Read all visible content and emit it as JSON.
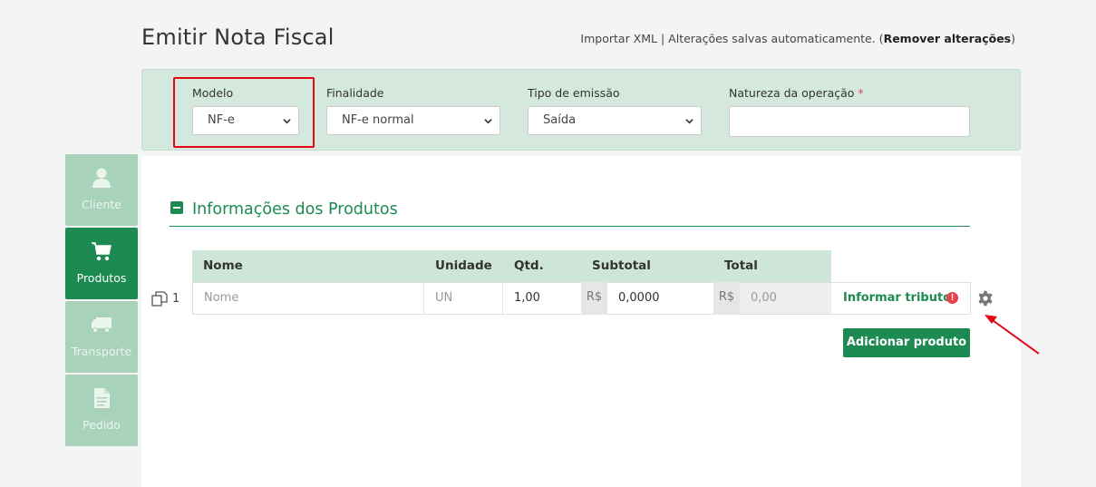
{
  "page": {
    "title": "Emitir Nota Fiscal",
    "import_xml": "Importar XML",
    "separator": " | ",
    "autosave": "Alterações salvas automaticamente. (",
    "remove_changes": "Remover alterações",
    "close_paren": ")"
  },
  "header_form": {
    "modelo": {
      "label": "Modelo",
      "value": "NF-e"
    },
    "finalidade": {
      "label": "Finalidade",
      "value": "NF-e normal"
    },
    "tipo_emissao": {
      "label": "Tipo de emissão",
      "value": "Saída"
    },
    "natureza": {
      "label": "Natureza da operação",
      "required_mark": "*",
      "value": ""
    }
  },
  "sidenav": {
    "items": [
      {
        "label": "Cliente",
        "icon": "user-icon",
        "active": false
      },
      {
        "label": "Produtos",
        "icon": "cart-icon",
        "active": true
      },
      {
        "label": "Transporte",
        "icon": "truck-icon",
        "active": false
      },
      {
        "label": "Pedido",
        "icon": "document-icon",
        "active": false
      }
    ]
  },
  "products": {
    "section_title": "Informações dos Produtos",
    "columns": [
      "Nome",
      "Unidade",
      "Qtd.",
      "Subtotal",
      "Total"
    ],
    "row": {
      "number": "1",
      "nome_placeholder": "Nome",
      "unidade": "UN",
      "qtd": "1,00",
      "currency": "R$",
      "subtotal": "0,0000",
      "total": "0,00"
    },
    "tributos_link": "Informar tributos",
    "warning_glyph": "!",
    "add_button": "Adicionar produto"
  },
  "colors": {
    "brand_green": "#1d8a52",
    "light_green": "#d5e8dd",
    "highlight_red": "#e30613"
  }
}
